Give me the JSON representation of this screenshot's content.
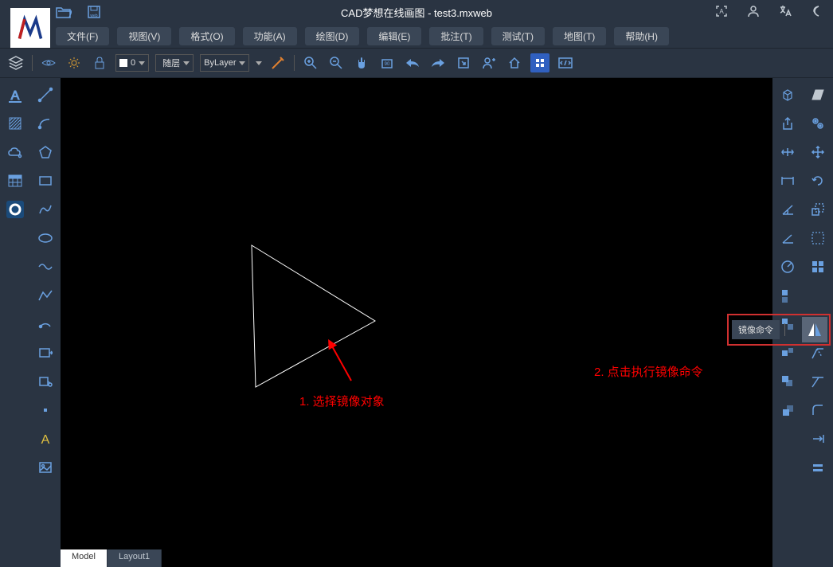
{
  "title": "CAD梦想在线画图 - test3.mxweb",
  "menubar": [
    "文件(F)",
    "视图(V)",
    "格式(O)",
    "功能(A)",
    "绘图(D)",
    "编辑(E)",
    "批注(T)",
    "测试(T)",
    "地图(T)",
    "帮助(H)"
  ],
  "layer_num": "0",
  "layer_style": "随层",
  "layer_bylayer": "ByLayer",
  "tabs": {
    "model": "Model",
    "layout1": "Layout1"
  },
  "annotations": {
    "step1": "1. 选择镜像对象",
    "step2": "2. 点击执行镜像命令"
  },
  "tooltip": "镜像命令"
}
